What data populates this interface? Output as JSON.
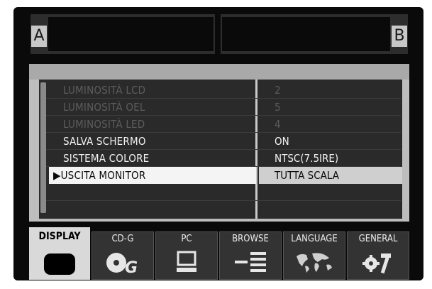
{
  "slots": {
    "a_label": "A",
    "b_label": "B"
  },
  "menu": {
    "rows": [
      {
        "label": "LUMINOSITÀ LCD",
        "value": "2",
        "state": "disabled"
      },
      {
        "label": "LUMINOSITÀ OEL",
        "value": "5",
        "state": "disabled"
      },
      {
        "label": "LUMINOSITÀ LED",
        "value": "4",
        "state": "disabled"
      },
      {
        "label": "SALVA SCHERMO",
        "value": "ON",
        "state": "enabled"
      },
      {
        "label": "SISTEMA COLORE",
        "value": "NTSC(7.5IRE)",
        "state": "enabled"
      },
      {
        "label": "USCITA MONITOR",
        "value": "TUTTA SCALA",
        "state": "selected"
      }
    ],
    "selected_marker": "▶"
  },
  "tabs": [
    {
      "label": "DISPLAY",
      "icon": "display-icon",
      "active": true
    },
    {
      "label": "CD-G",
      "icon": "cdg-icon",
      "active": false
    },
    {
      "label": "PC",
      "icon": "pc-icon",
      "active": false
    },
    {
      "label": "BROWSE",
      "icon": "browse-icon",
      "active": false
    },
    {
      "label": "LANGUAGE",
      "icon": "globe-icon",
      "active": false
    },
    {
      "label": "GENERAL",
      "icon": "tools-icon",
      "active": false
    }
  ],
  "colors": {
    "background": "#0a0a0a",
    "menu_frame": "#bdbdbd",
    "highlight": "#f4f4f4",
    "dim_text": "#5c5c5c"
  }
}
